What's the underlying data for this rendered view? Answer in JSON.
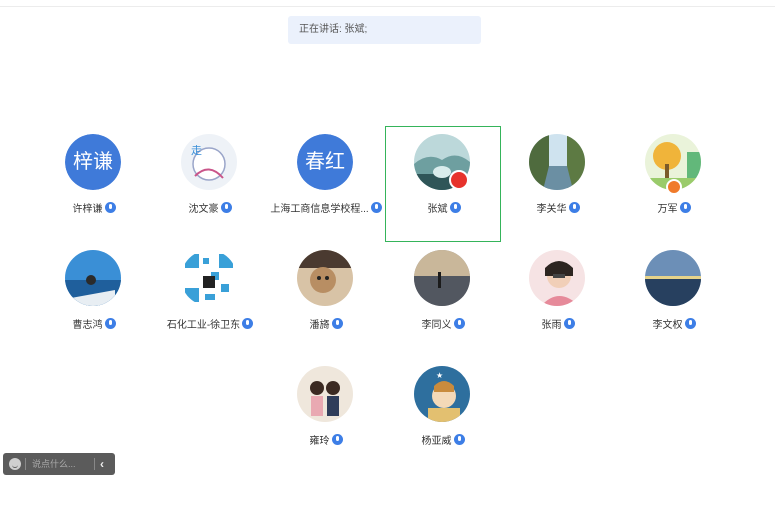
{
  "speaking_banner": "正在讲话: 张斌;",
  "participants": [
    {
      "name": "许梓谦",
      "avatar_text": "梓谦",
      "muted": false
    },
    {
      "name": "沈文豪",
      "avatar_text": "",
      "muted": false
    },
    {
      "name": "上海工商信息学校程...",
      "avatar_text": "春红",
      "muted": false
    },
    {
      "name": "张斌",
      "avatar_text": "",
      "muted": false,
      "speaking": true
    },
    {
      "name": "李关华",
      "avatar_text": "",
      "muted": false
    },
    {
      "name": "万军",
      "avatar_text": "",
      "muted": false
    },
    {
      "name": "曹志鸿",
      "avatar_text": "",
      "muted": false
    },
    {
      "name": "石化工业-徐卫东",
      "avatar_text": "",
      "muted": false
    },
    {
      "name": "潘旖",
      "avatar_text": "",
      "muted": false
    },
    {
      "name": "李同义",
      "avatar_text": "",
      "muted": false
    },
    {
      "name": "张雨",
      "avatar_text": "",
      "muted": false
    },
    {
      "name": "李文权",
      "avatar_text": "",
      "muted": false
    },
    {
      "name": "雍玲",
      "avatar_text": "",
      "muted": false
    },
    {
      "name": "杨亚威",
      "avatar_text": "",
      "muted": false
    }
  ],
  "chat": {
    "placeholder": "说点什么...",
    "collapse_icon": "‹"
  },
  "colors": {
    "accent": "#3d7ee6",
    "speaking_border": "#35b45a",
    "banner_bg": "#ebf1fc"
  }
}
